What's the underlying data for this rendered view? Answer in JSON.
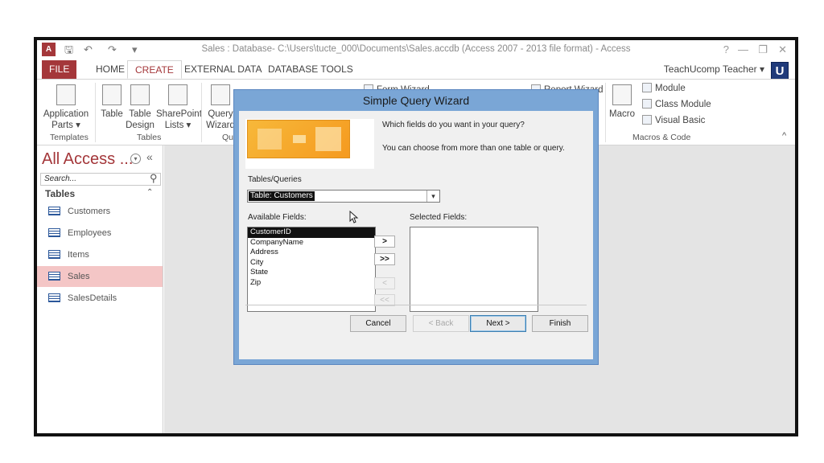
{
  "window": {
    "app_icon": "A",
    "title": "Sales : Database- C:\\Users\\tucte_000\\Documents\\Sales.accdb (Access 2007 - 2013 file format) - Access",
    "help": "?",
    "minimize": "—",
    "restore": "❐",
    "close": "✕"
  },
  "qat": {
    "save": "🖫",
    "undo": "↶",
    "redo": "↷",
    "customize": "▾"
  },
  "tabs": [
    "FILE",
    "HOME",
    "CREATE",
    "EXTERNAL DATA",
    "DATABASE TOOLS"
  ],
  "user": {
    "name": "TeachUcomp Teacher ▾",
    "logo": "U"
  },
  "ribbon": {
    "app_parts": "Application Parts ▾",
    "table": "Table",
    "table_design": "Table Design",
    "sharepoint_lists": "SharePoint Lists ▾",
    "query_wizard": "Query Wizard",
    "form_wizard": "Form Wizard",
    "report_wizard": "Report Wizard",
    "macro": "Macro",
    "module": "Module",
    "class_module": "Class Module",
    "visual_basic": "Visual Basic",
    "groups": {
      "templates": "Templates",
      "tables": "Tables",
      "queries": "Que",
      "macros_code": "Macros & Code"
    },
    "collapse": "^"
  },
  "nav": {
    "title": "All Access ...",
    "menu_glyph": "▾",
    "collapse_glyph": "«",
    "search_placeholder": "Search...",
    "search_icon": "⚲",
    "section": "Tables",
    "section_chevron": "⌃",
    "items": [
      "Customers",
      "Employees",
      "Items",
      "Sales",
      "SalesDetails"
    ],
    "selected_item": "Sales"
  },
  "dialog": {
    "title": "Simple Query Wizard",
    "question": "Which fields do you want in your query?",
    "hint": "You can choose from more than one table or query.",
    "tables_label": "Tables/Queries",
    "combo_value": "Table: Customers",
    "combo_arrow": "▾",
    "available_label": "Available Fields:",
    "selected_label": "Selected Fields:",
    "available_fields": [
      "CustomerID",
      "CompanyName",
      "Address",
      "City",
      "State",
      "Zip"
    ],
    "selected_fields": [],
    "move_buttons": {
      "add_one": ">",
      "add_all": ">>",
      "remove_one": "<",
      "remove_all": "<<"
    },
    "buttons": {
      "cancel": "Cancel",
      "back": "< Back",
      "next": "Next >",
      "finish": "Finish"
    }
  },
  "colors": {
    "access_red": "#a4373a",
    "dialog_frame": "#7aa6d6",
    "selection_pink": "#f4c6c6"
  }
}
